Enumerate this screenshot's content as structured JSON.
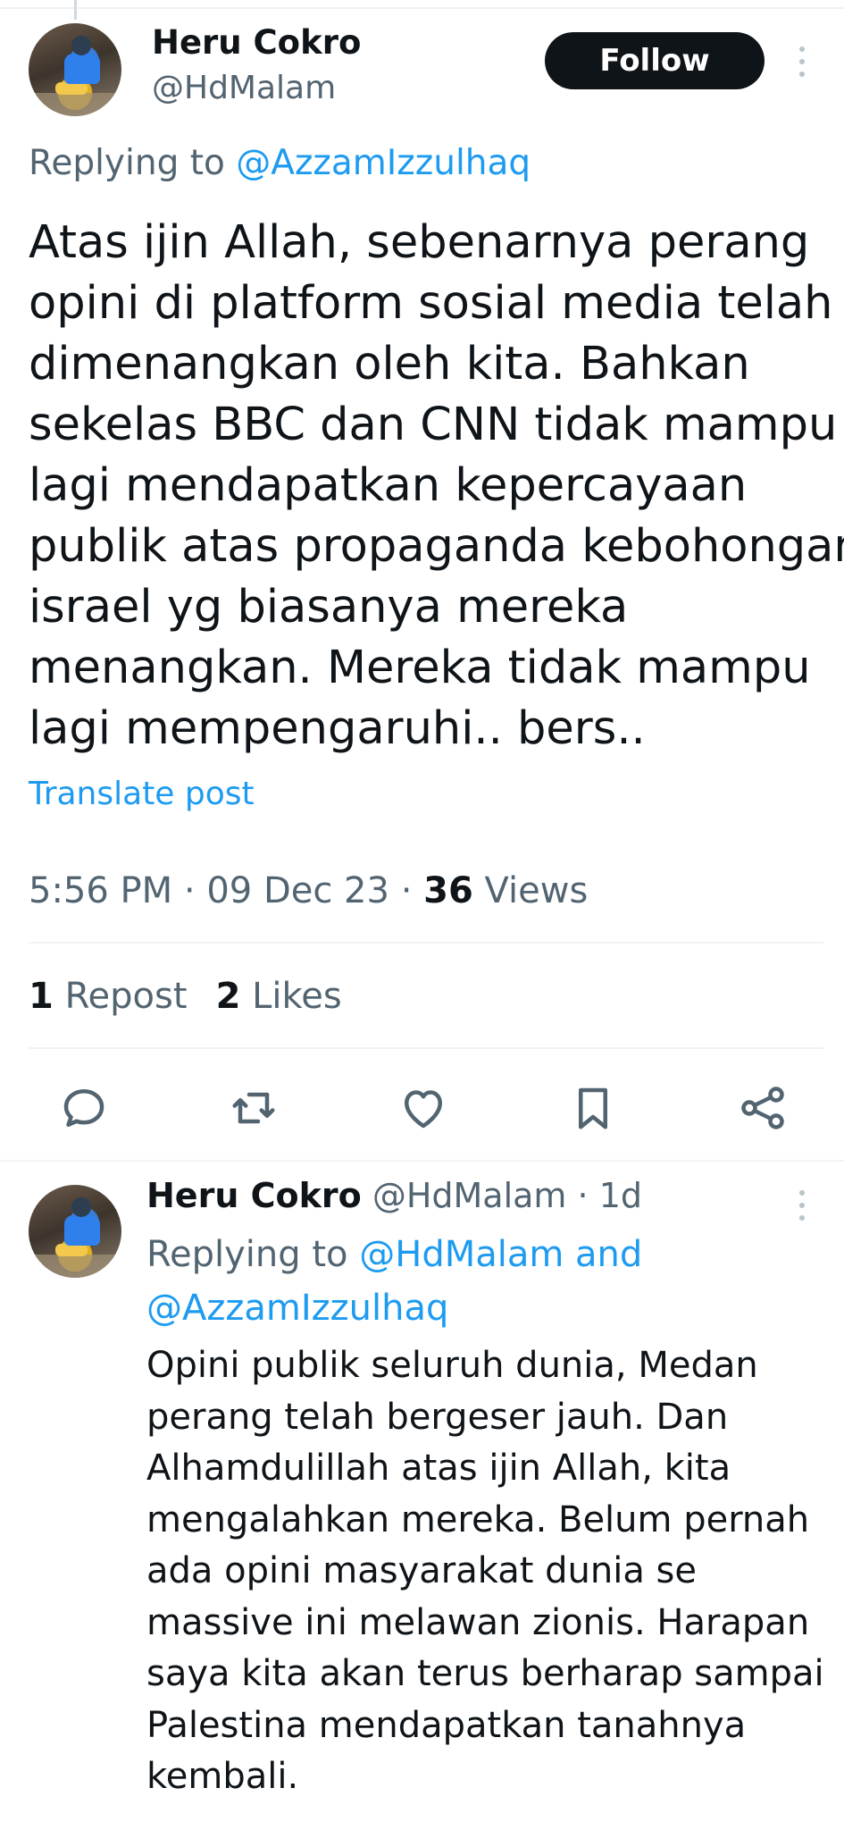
{
  "post": {
    "author": {
      "name": "Heru Cokro",
      "handle": "@HdMalam"
    },
    "follow_label": "Follow",
    "replying_prefix": "Replying to",
    "replying_to": "@AzzamIzzulhaq",
    "text_lines": [
      "Atas ijin Allah, sebenarnya perang",
      "opini di platform sosial media telah",
      "dimenangkan oleh kita. Bahkan",
      "sekelas BBC dan CNN tidak mampu",
      "lagi mendapatkan kepercayaan",
      "publik atas propaganda kebohongan",
      "israel yg biasanya mereka",
      "menangkan. Mereka tidak mampu",
      "lagi mempengaruhi.. bers.."
    ],
    "translate_label": "Translate post",
    "time": "5:56 PM",
    "date": "09 Dec 23",
    "views_count": "36",
    "views_label": "Views",
    "reposts_count": "1",
    "reposts_label": "Repost",
    "likes_count": "2",
    "likes_label": "Likes"
  },
  "actions": {
    "reply_icon": "reply-icon",
    "repost_icon": "repost-icon",
    "like_icon": "heart-icon",
    "bookmark_icon": "bookmark-icon",
    "share_icon": "share-icon"
  },
  "reply": {
    "author": {
      "name": "Heru Cokro",
      "handle": "@HdMalam",
      "age": "1d"
    },
    "replying_prefix": "Replying to",
    "replying_to_1": "@HdMalam",
    "replying_and": "and",
    "replying_to_2": "@AzzamIzzulhaq",
    "text_lines": [
      "Opini publik seluruh dunia, Medan",
      "perang telah bergeser jauh. Dan",
      "Alhamdulillah atas ijin Allah, kita",
      "mengalahkan mereka. Belum pernah",
      "ada opini masyarakat dunia se",
      "massive ini melawan zionis. Harapan",
      "saya kita akan terus berharap sampai",
      "Palestina mendapatkan tanahnya",
      "kembali."
    ]
  },
  "colors": {
    "text": "#0f1419",
    "secondary": "#536471",
    "link": "#1d9bf0",
    "button": "#0f1419",
    "divider": "#eff3f4"
  }
}
